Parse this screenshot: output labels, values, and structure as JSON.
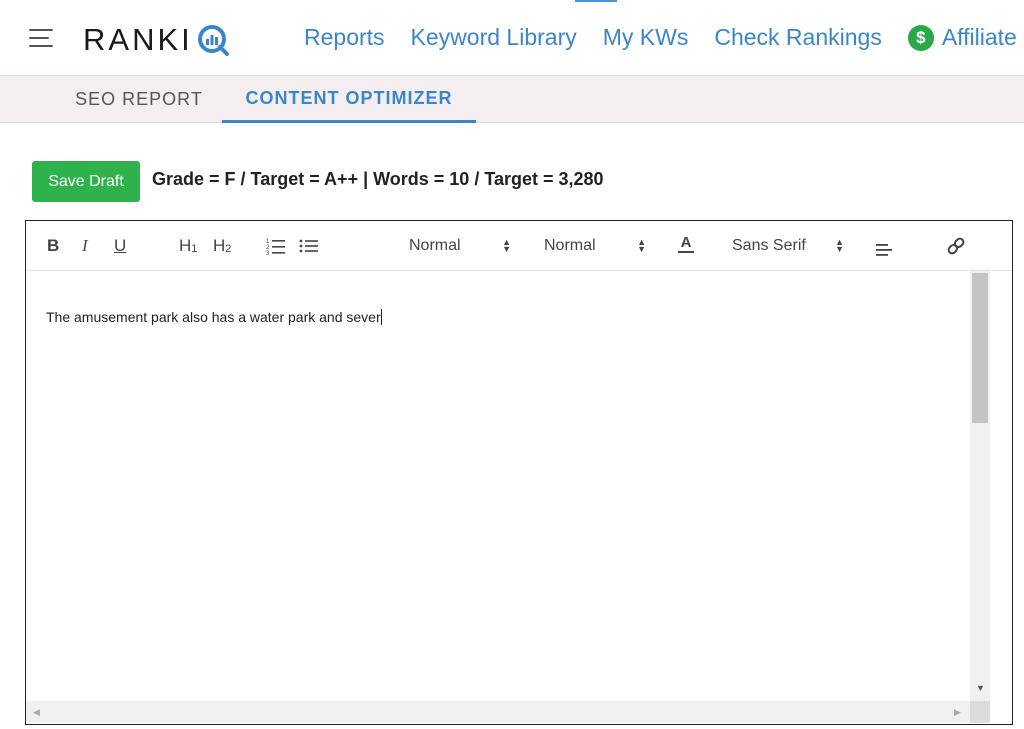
{
  "nav": {
    "brand_text": "RANKI",
    "brand_logo_letter": "Q",
    "links": [
      "Reports",
      "Keyword Library",
      "My KWs",
      "Check Rankings"
    ],
    "affiliate_label": "Affiliate",
    "affiliate_symbol": "$"
  },
  "tabs": {
    "seo_report": "SEO REPORT",
    "content_optimizer": "CONTENT OPTIMIZER"
  },
  "status": {
    "save_label": "Save Draft",
    "summary": "Grade = F / Target = A++  |  Words = 10 / Target = 3,280"
  },
  "toolbar": {
    "bold": "B",
    "italic": "I",
    "underline": "U",
    "h1_main": "H",
    "h1_sub": "1",
    "h2_main": "H",
    "h2_sub": "2",
    "size_select": "Normal",
    "header_select": "Normal",
    "color_glyph": "A",
    "font_select": "Sans Serif"
  },
  "editor": {
    "text": "The amusement park also has a water park and sever"
  },
  "colors": {
    "accent": "#3b86c9",
    "save_green": "#2fb24c",
    "tab_bar_bg": "#f4eef0"
  },
  "icons": [
    "hamburger-icon",
    "rankiq-q-icon",
    "dollar-icon",
    "ordered-list-icon",
    "bullet-list-icon",
    "text-color-icon",
    "align-icon",
    "link-icon",
    "scroll-down-icon",
    "scroll-left-icon",
    "scroll-right-icon"
  ]
}
